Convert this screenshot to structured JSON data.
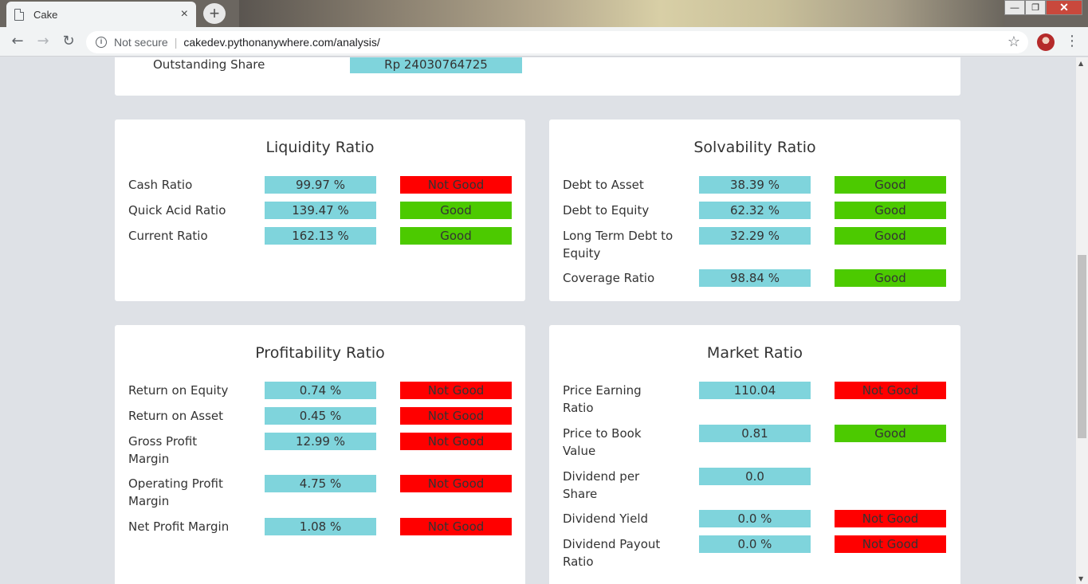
{
  "browser": {
    "tab_title": "Cake",
    "tab_close": "×",
    "new_tab": "+",
    "security": "Not secure",
    "url": "cakedev.pythonanywhere.com/analysis/",
    "back": "←",
    "forward": "→",
    "reload": "↻",
    "star": "☆",
    "menu": "⋮",
    "win_min": "—",
    "win_max": "❐",
    "win_close": "✕"
  },
  "top": {
    "label": "Outstanding Share",
    "value": "Rp 24030764725"
  },
  "liquidity": {
    "title": "Liquidity Ratio",
    "rows": [
      {
        "label": "Cash Ratio",
        "value": "99.97 %",
        "status": "Not Good"
      },
      {
        "label": "Quick Acid Ratio",
        "value": "139.47 %",
        "status": "Good"
      },
      {
        "label": "Current Ratio",
        "value": "162.13 %",
        "status": "Good"
      }
    ]
  },
  "solvability": {
    "title": "Solvability Ratio",
    "rows": [
      {
        "label": "Debt to Asset",
        "value": "38.39 %",
        "status": "Good"
      },
      {
        "label": "Debt to Equity",
        "value": "62.32 %",
        "status": "Good"
      },
      {
        "label": "Long Term Debt to Equity",
        "value": "32.29 %",
        "status": "Good"
      },
      {
        "label": "Coverage Ratio",
        "value": "98.84 %",
        "status": "Good"
      }
    ]
  },
  "profitability": {
    "title": "Profitability Ratio",
    "rows": [
      {
        "label": "Return on Equity",
        "value": "0.74 %",
        "status": "Not Good"
      },
      {
        "label": "Return on Asset",
        "value": "0.45 %",
        "status": "Not Good"
      },
      {
        "label": "Gross Profit Margin",
        "value": "12.99 %",
        "status": "Not Good"
      },
      {
        "label": "Operating Profit Margin",
        "value": "4.75 %",
        "status": "Not Good"
      },
      {
        "label": "Net Profit Margin",
        "value": "1.08 %",
        "status": "Not Good"
      }
    ]
  },
  "market": {
    "title": "Market Ratio",
    "rows": [
      {
        "label": "Price Earning Ratio",
        "value": "110.04",
        "status": "Not Good"
      },
      {
        "label": "Price to Book Value",
        "value": "0.81",
        "status": "Good"
      },
      {
        "label": "Dividend per Share",
        "value": "0.0",
        "status": ""
      },
      {
        "label": "Dividend Yield",
        "value": "0.0 %",
        "status": "Not Good"
      },
      {
        "label": "Dividend Payout Ratio",
        "value": "0.0 %",
        "status": "Not Good"
      }
    ]
  },
  "colors": {
    "value_bg": "#7fd4dc",
    "good": "#4cca00",
    "not_good": "#ff0000",
    "page_bg": "#dee1e6"
  }
}
